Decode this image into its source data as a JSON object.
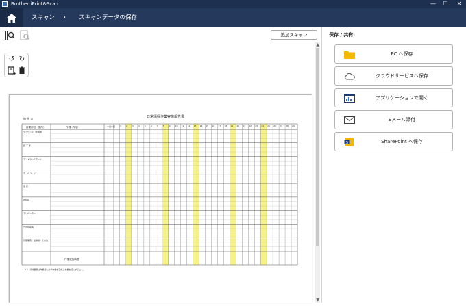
{
  "window": {
    "title": "Brother iPrint&Scan",
    "minimize": "—",
    "maximize": "☐",
    "close": "✕"
  },
  "nav": {
    "crumb1": "スキャン",
    "sep": "›",
    "crumb2": "スキャンデータの保存"
  },
  "toolbar": {
    "add_scan_label": "追加スキャン"
  },
  "right_panel": {
    "title": "保存 / 共有:",
    "actions": [
      {
        "label": "PC へ保存",
        "icon": "folder-icon"
      },
      {
        "label": "クラウドサービスへ保存",
        "icon": "cloud-icon"
      },
      {
        "label": "アプリケーションで開く",
        "icon": "app-window-icon"
      },
      {
        "label": "Eメール添付",
        "icon": "mail-icon"
      },
      {
        "label": "SharePoint へ保存",
        "icon": "sharepoint-icon"
      }
    ]
  },
  "document": {
    "title": "日常清掃作業実施報告書",
    "property_label": "物 件 名",
    "col_area": "作業部位（箇所）",
    "col_content": "作 業 内 容",
    "col_freq": "一日一回",
    "days": [
      "1",
      "2",
      "3",
      "4",
      "5",
      "6",
      "7",
      "8",
      "9",
      "10",
      "11",
      "12",
      "13",
      "14",
      "15",
      "16",
      "17",
      "18",
      "19",
      "20",
      "21",
      "22",
      "23",
      "24",
      "25",
      "26",
      "27",
      "28",
      "29"
    ],
    "sections": [
      "グラウンド（玄関前）",
      "廊 下 等",
      "エントランスホール",
      "ホームページー",
      "便 所",
      "内階段",
      "エレベーター",
      "共用施設等",
      "管理事務・給湯場・その他"
    ],
    "footer_row": "作業実施時間",
    "note": "※１. 清掃業務は作業日に必ず作業を実施し本書を記入すること。"
  }
}
